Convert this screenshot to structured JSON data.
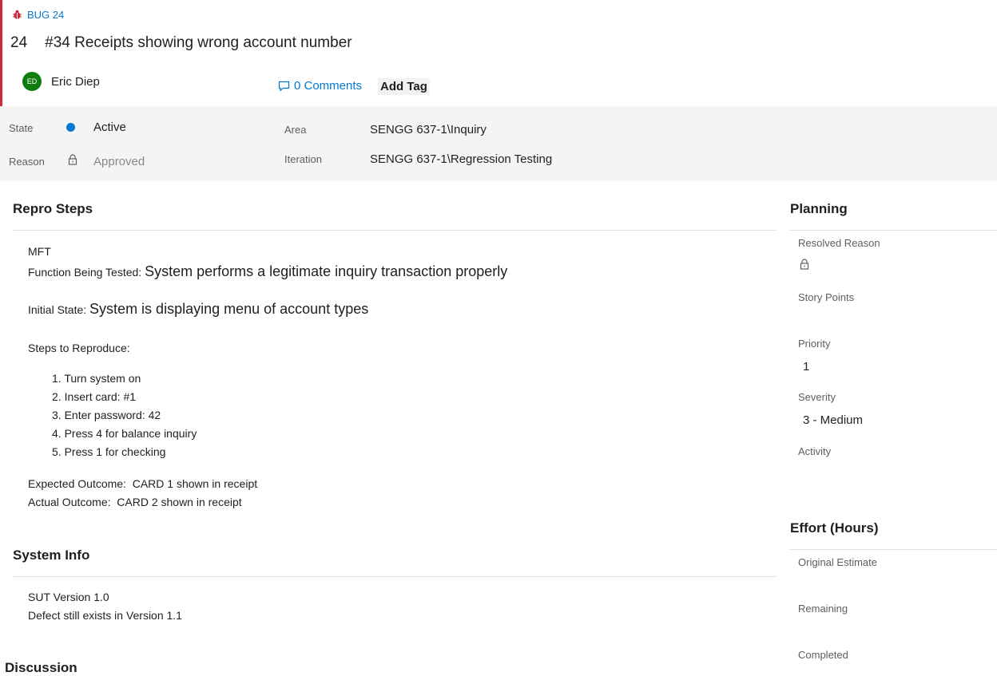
{
  "header": {
    "badge": "BUG 24",
    "work_item_id": "24",
    "title": "#34 Receipts showing wrong account number",
    "user_initials": "ED",
    "user_name": "Eric Diep",
    "comments": "0 Comments",
    "add_tag": "Add Tag"
  },
  "fields": {
    "state_label": "State",
    "state_value": "Active",
    "reason_label": "Reason",
    "reason_value": "Approved",
    "area_label": "Area",
    "area_value": "SENGG 637-1\\Inquiry",
    "iteration_label": "Iteration",
    "iteration_value": "SENGG 637-1\\Regression Testing"
  },
  "repro": {
    "title": "Repro Steps",
    "mft": "MFT",
    "function_label": "Function Being Tested:",
    "function_value": "System performs a legitimate inquiry transaction properly",
    "initial_label": "Initial State:",
    "initial_value": "System is displaying menu of account types",
    "steps_label": "Steps to Reproduce:",
    "steps": [
      "1. Turn system on",
      "2. Insert card: #1",
      "3. Enter password: 42",
      "4. Press 4 for balance inquiry",
      "5. Press 1 for checking"
    ],
    "expected": "Expected Outcome:  CARD 1 shown in receipt",
    "actual": "Actual Outcome:  CARD 2 shown in receipt"
  },
  "system_info": {
    "title": "System Info",
    "lines": [
      "SUT Version 1.0",
      "Defect still exists in Version 1.1"
    ]
  },
  "discussion": {
    "title": "Discussion"
  },
  "planning": {
    "title": "Planning",
    "resolved_reason_label": "Resolved Reason",
    "story_points_label": "Story Points",
    "priority_label": "Priority",
    "priority_value": "1",
    "severity_label": "Severity",
    "severity_value": "3 - Medium",
    "activity_label": "Activity"
  },
  "effort": {
    "title": "Effort (Hours)",
    "original_estimate_label": "Original Estimate",
    "remaining_label": "Remaining",
    "completed_label": "Completed"
  },
  "colors": {
    "accent": "#0078d4",
    "bug_red": "#cc293d",
    "avatar_green": "#107c10"
  }
}
